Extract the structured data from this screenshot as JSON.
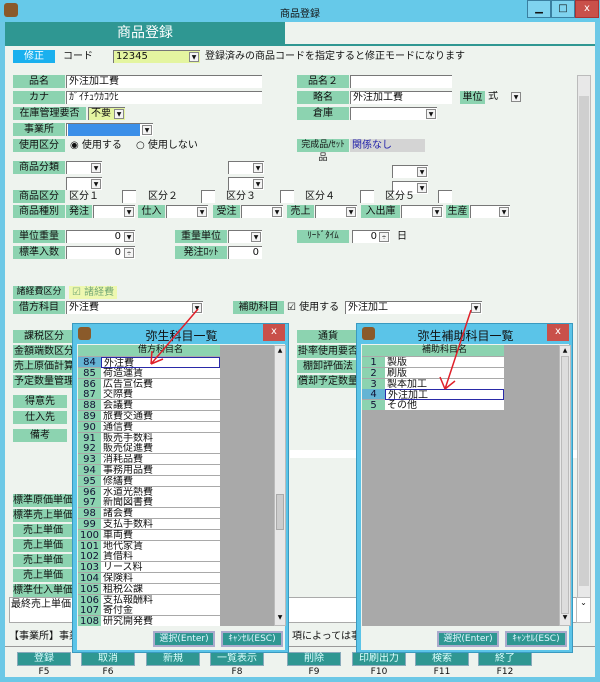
{
  "window": {
    "title": "商品登録",
    "minimize": "▁",
    "maximize": "□",
    "close": "x"
  },
  "header": {
    "title": "商品登録"
  },
  "mode": {
    "badge": "修正",
    "code_label": "コード",
    "code_value": "12345",
    "hint": "登録済みの商品コードを指定すると修正モードになります"
  },
  "fields": {
    "hinmei": {
      "label": "品名",
      "value": "外注加工費"
    },
    "hinmei2": {
      "label": "品名２",
      "value": ""
    },
    "kana": {
      "label": "カナ",
      "value": "ｶﾞｲﾁｭｳｶｺｳﾋ"
    },
    "ryakumei": {
      "label": "略名",
      "value": "外注加工費"
    },
    "tani": {
      "label": "単位",
      "value": "式"
    },
    "zaiko": {
      "label": "在庫管理要否",
      "value": "不要"
    },
    "souko": {
      "label": "倉庫",
      "value": ""
    },
    "jigyousho": {
      "label": "事業所",
      "value": ""
    },
    "shiyou": {
      "label": "使用区分",
      "opt1": "使用する",
      "opt2": "使用しない",
      "selected": "使用する"
    },
    "kansei": {
      "label": "完成品/ｾｯﾄ品",
      "value": "関係なし"
    },
    "bunrui": {
      "label": "商品分類"
    },
    "kubun": {
      "label": "商品区分",
      "items": [
        "区分１",
        "区分２",
        "区分３",
        "区分４",
        "区分５"
      ]
    },
    "shubetsu": {
      "label": "商品種別",
      "items": [
        "発注",
        "仕入",
        "受注",
        "売上",
        "入出庫",
        "生産"
      ]
    },
    "tani_juryo": {
      "label": "単位重量",
      "value": "0"
    },
    "juryo_tani": {
      "label": "重量単位",
      "value": ""
    },
    "leadtime": {
      "label": "ﾘｰﾄﾞﾀｲﾑ",
      "value": "0",
      "unit": "日"
    },
    "hyojun_irisu": {
      "label": "標準入数",
      "value": "0"
    },
    "hachu_lot": {
      "label": "発注ﾛｯﾄ",
      "value": "0"
    },
    "shokeihi": {
      "label": "諸経費区分",
      "check_label": "諸経費",
      "checked": true
    },
    "karikata": {
      "label": "借方科目",
      "value": "外注費"
    },
    "hojo": {
      "label": "補助科目",
      "check_label": "使用する",
      "checked": true,
      "value": "外注加工"
    },
    "left_labels": [
      "課税区分",
      "金額端数区分",
      "売上原価計算",
      "予定数量管理"
    ],
    "right_labels": [
      "通貨",
      "掛率使用要否",
      "棚卸評価法",
      "償却予定数量"
    ],
    "partner_labels": [
      "得意先",
      "仕入先",
      "備考"
    ],
    "price_labels": [
      "標準原価単価",
      "標準売上単価",
      "売上単価",
      "売上単価",
      "売上単価",
      "売上単価",
      "標準仕入単価"
    ],
    "last_price_label": "最終売上単価"
  },
  "info": {
    "left": "【事業所】事業",
    "right": "項によっては事業"
  },
  "fkeys": [
    {
      "label": "登録",
      "key": "F5"
    },
    {
      "label": "取消",
      "key": "F6"
    },
    {
      "label": "新規",
      "key": ""
    },
    {
      "label": "一覧表示",
      "key": "F8"
    },
    {
      "label": "削除",
      "key": "F9"
    },
    {
      "label": "印刷出力",
      "key": "F10"
    },
    {
      "label": "検索",
      "key": "F11"
    },
    {
      "label": "終了",
      "key": "F12"
    }
  ],
  "dialog1": {
    "title": "弥生科目一覧",
    "column": "借方科目名",
    "selected": "84",
    "ok": "選択(Enter)",
    "cancel": "ｷｬﾝｾﾙ(ESC)",
    "rows": [
      [
        "84",
        "外注費"
      ],
      [
        "85",
        "荷造運賃"
      ],
      [
        "86",
        "広告宣伝費"
      ],
      [
        "87",
        "交際費"
      ],
      [
        "88",
        "会議費"
      ],
      [
        "89",
        "旅費交通費"
      ],
      [
        "90",
        "通信費"
      ],
      [
        "91",
        "販売手数料"
      ],
      [
        "92",
        "販売促進費"
      ],
      [
        "93",
        "消耗品費"
      ],
      [
        "94",
        "事務用品費"
      ],
      [
        "95",
        "修繕費"
      ],
      [
        "96",
        "水道光熱費"
      ],
      [
        "97",
        "新聞図書費"
      ],
      [
        "98",
        "諸会費"
      ],
      [
        "99",
        "支払手数料"
      ],
      [
        "100",
        "車両費"
      ],
      [
        "101",
        "地代家賃"
      ],
      [
        "102",
        "賃借料"
      ],
      [
        "103",
        "リース料"
      ],
      [
        "104",
        "保険料"
      ],
      [
        "105",
        "租税公課"
      ],
      [
        "106",
        "支払報酬料"
      ],
      [
        "107",
        "寄付金"
      ],
      [
        "108",
        "研究開発費"
      ]
    ]
  },
  "dialog2": {
    "title": "弥生補助科目一覧",
    "column": "補助科目名",
    "selected": "4",
    "ok": "選択(Enter)",
    "cancel": "ｷｬﾝｾﾙ(ESC)",
    "rows": [
      [
        "1",
        "製版"
      ],
      [
        "2",
        "刷版"
      ],
      [
        "3",
        "製本加工"
      ],
      [
        "4",
        "外注加工"
      ],
      [
        "5",
        "その他"
      ]
    ]
  },
  "colors": {
    "label_bg": "#8cd3b0",
    "header_teal": "#2f9792",
    "titlebar": "#66c9e9",
    "annotation_arrow": "#e0202a"
  }
}
